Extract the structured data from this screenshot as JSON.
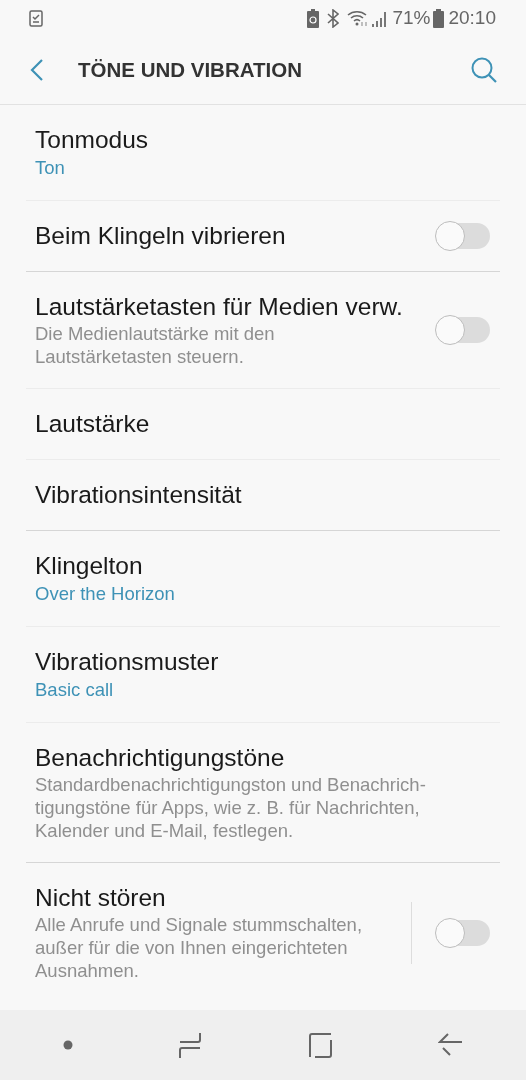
{
  "status_bar": {
    "battery_percent": "71%",
    "time": "20:10"
  },
  "header": {
    "title": "TÖNE UND VIBRATION"
  },
  "sections": [
    {
      "items": [
        {
          "kind": "value",
          "title": "Tonmodus",
          "value": "Ton"
        },
        {
          "kind": "switch",
          "title": "Beim Klingeln vibrieren",
          "on": false
        }
      ]
    },
    {
      "items": [
        {
          "kind": "switch",
          "title": "Lautstärketasten für Medien verw.",
          "description": "Die Medienlautstärke mit den Lautstärketasten steuern.",
          "on": false
        },
        {
          "kind": "plain",
          "title": "Lautstärke"
        },
        {
          "kind": "plain",
          "title": "Vibrationsintensität"
        }
      ]
    },
    {
      "items": [
        {
          "kind": "value",
          "title": "Klingelton",
          "value": "Over the Horizon"
        },
        {
          "kind": "value",
          "title": "Vibrationsmuster",
          "value": "Basic call"
        },
        {
          "kind": "plain",
          "title": "Benachrichtigungstöne",
          "description": "Standardbenachrichtigungston und Benachrich-tigungstöne für Apps, wie z. B. für Nachrichten, Kalender und E-Mail, festlegen."
        }
      ]
    },
    {
      "items": [
        {
          "kind": "switch",
          "title": "Nicht stören",
          "description": "Alle Anrufe und Signale stummschalten, außer für die von Ihnen eingerichteten Ausnahmen.",
          "on": false,
          "separator": true
        }
      ]
    }
  ]
}
